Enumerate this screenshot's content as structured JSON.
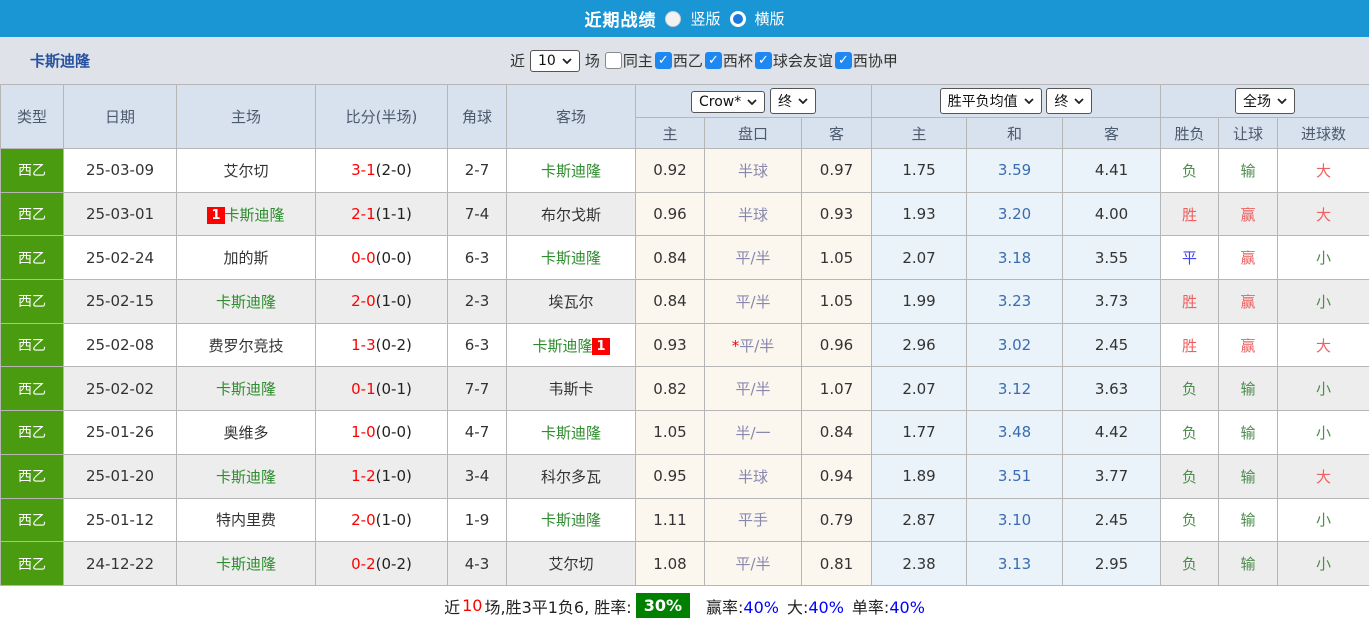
{
  "header_bar": {
    "title": "近期战绩",
    "radio_vertical_label": "竖版",
    "radio_horizontal_label": "横版",
    "selected": "横版"
  },
  "filter_bar": {
    "team": "卡斯迪隆",
    "near_label": "近",
    "near_value": "10",
    "games_label": "场",
    "checkboxes": [
      {
        "label": "同主",
        "checked": false
      },
      {
        "label": "西乙",
        "checked": true
      },
      {
        "label": "西杯",
        "checked": true
      },
      {
        "label": "球会友谊",
        "checked": true
      },
      {
        "label": "西协甲",
        "checked": true
      }
    ]
  },
  "table": {
    "static_headers": [
      "类型",
      "日期",
      "主场",
      "比分(半场)",
      "角球",
      "客场"
    ],
    "groups": [
      {
        "select1": "Crow*",
        "select2": "终",
        "cols": [
          "主",
          "盘口",
          "客"
        ]
      },
      {
        "select1": "胜平负均值",
        "select2": "终",
        "cols": [
          "主",
          "和",
          "客"
        ]
      },
      {
        "select1": "全场",
        "select2": null,
        "cols": [
          "胜负",
          "让球",
          "进球数"
        ]
      }
    ],
    "rows": [
      {
        "type": "西乙",
        "date": "25-03-09",
        "home": {
          "name": "艾尔切",
          "highlight": false,
          "badge": null,
          "badge_pos": null
        },
        "score_ft": "3-1",
        "score_ht": "(2-0)",
        "corner": "2-7",
        "away": {
          "name": "卡斯迪隆",
          "highlight": true,
          "badge": null,
          "badge_pos": null
        },
        "odds_home": "0.92",
        "handicap": "半球",
        "handicap_star": false,
        "odds_away": "0.97",
        "avg_home": "1.75",
        "avg_draw": "3.59",
        "avg_away": "4.41",
        "result": {
          "outcome": "负",
          "outcome_color": "green",
          "handicap": "输",
          "handicap_color": "green",
          "goals": "大",
          "goals_color": "red"
        }
      },
      {
        "type": "西乙",
        "date": "25-03-01",
        "home": {
          "name": "卡斯迪隆",
          "highlight": true,
          "badge": "1",
          "badge_pos": "before"
        },
        "score_ft": "2-1",
        "score_ht": "(1-1)",
        "corner": "7-4",
        "away": {
          "name": "布尔戈斯",
          "highlight": false,
          "badge": null,
          "badge_pos": null
        },
        "odds_home": "0.96",
        "handicap": "半球",
        "handicap_star": false,
        "odds_away": "0.93",
        "avg_home": "1.93",
        "avg_draw": "3.20",
        "avg_away": "4.00",
        "result": {
          "outcome": "胜",
          "outcome_color": "red",
          "handicap": "赢",
          "handicap_color": "red",
          "goals": "大",
          "goals_color": "red"
        }
      },
      {
        "type": "西乙",
        "date": "25-02-24",
        "home": {
          "name": "加的斯",
          "highlight": false,
          "badge": null,
          "badge_pos": null
        },
        "score_ft": "0-0",
        "score_ht": "(0-0)",
        "corner": "6-3",
        "away": {
          "name": "卡斯迪隆",
          "highlight": true,
          "badge": null,
          "badge_pos": null
        },
        "odds_home": "0.84",
        "handicap": "平/半",
        "handicap_star": false,
        "odds_away": "1.05",
        "avg_home": "2.07",
        "avg_draw": "3.18",
        "avg_away": "3.55",
        "result": {
          "outcome": "平",
          "outcome_color": "blue",
          "handicap": "赢",
          "handicap_color": "red",
          "goals": "小",
          "goals_color": "green"
        }
      },
      {
        "type": "西乙",
        "date": "25-02-15",
        "home": {
          "name": "卡斯迪隆",
          "highlight": true,
          "badge": null,
          "badge_pos": null
        },
        "score_ft": "2-0",
        "score_ht": "(1-0)",
        "corner": "2-3",
        "away": {
          "name": "埃瓦尔",
          "highlight": false,
          "badge": null,
          "badge_pos": null
        },
        "odds_home": "0.84",
        "handicap": "平/半",
        "handicap_star": false,
        "odds_away": "1.05",
        "avg_home": "1.99",
        "avg_draw": "3.23",
        "avg_away": "3.73",
        "result": {
          "outcome": "胜",
          "outcome_color": "red",
          "handicap": "赢",
          "handicap_color": "red",
          "goals": "小",
          "goals_color": "green"
        }
      },
      {
        "type": "西乙",
        "date": "25-02-08",
        "home": {
          "name": "费罗尔竞技",
          "highlight": false,
          "badge": null,
          "badge_pos": null
        },
        "score_ft": "1-3",
        "score_ht": "(0-2)",
        "corner": "6-3",
        "away": {
          "name": "卡斯迪隆",
          "highlight": true,
          "badge": "1",
          "badge_pos": "after"
        },
        "odds_home": "0.93",
        "handicap": "平/半",
        "handicap_star": true,
        "odds_away": "0.96",
        "avg_home": "2.96",
        "avg_draw": "3.02",
        "avg_away": "2.45",
        "result": {
          "outcome": "胜",
          "outcome_color": "red",
          "handicap": "赢",
          "handicap_color": "red",
          "goals": "大",
          "goals_color": "red"
        }
      },
      {
        "type": "西乙",
        "date": "25-02-02",
        "home": {
          "name": "卡斯迪隆",
          "highlight": true,
          "badge": null,
          "badge_pos": null
        },
        "score_ft": "0-1",
        "score_ht": "(0-1)",
        "corner": "7-7",
        "away": {
          "name": "韦斯卡",
          "highlight": false,
          "badge": null,
          "badge_pos": null
        },
        "odds_home": "0.82",
        "handicap": "平/半",
        "handicap_star": false,
        "odds_away": "1.07",
        "avg_home": "2.07",
        "avg_draw": "3.12",
        "avg_away": "3.63",
        "result": {
          "outcome": "负",
          "outcome_color": "green",
          "handicap": "输",
          "handicap_color": "green",
          "goals": "小",
          "goals_color": "green"
        }
      },
      {
        "type": "西乙",
        "date": "25-01-26",
        "home": {
          "name": "奥维多",
          "highlight": false,
          "badge": null,
          "badge_pos": null
        },
        "score_ft": "1-0",
        "score_ht": "(0-0)",
        "corner": "4-7",
        "away": {
          "name": "卡斯迪隆",
          "highlight": true,
          "badge": null,
          "badge_pos": null
        },
        "odds_home": "1.05",
        "handicap": "半/一",
        "handicap_star": false,
        "odds_away": "0.84",
        "avg_home": "1.77",
        "avg_draw": "3.48",
        "avg_away": "4.42",
        "result": {
          "outcome": "负",
          "outcome_color": "green",
          "handicap": "输",
          "handicap_color": "green",
          "goals": "小",
          "goals_color": "green"
        }
      },
      {
        "type": "西乙",
        "date": "25-01-20",
        "home": {
          "name": "卡斯迪隆",
          "highlight": true,
          "badge": null,
          "badge_pos": null
        },
        "score_ft": "1-2",
        "score_ht": "(1-0)",
        "corner": "3-4",
        "away": {
          "name": "科尔多瓦",
          "highlight": false,
          "badge": null,
          "badge_pos": null
        },
        "odds_home": "0.95",
        "handicap": "半球",
        "handicap_star": false,
        "odds_away": "0.94",
        "avg_home": "1.89",
        "avg_draw": "3.51",
        "avg_away": "3.77",
        "result": {
          "outcome": "负",
          "outcome_color": "green",
          "handicap": "输",
          "handicap_color": "green",
          "goals": "大",
          "goals_color": "red"
        }
      },
      {
        "type": "西乙",
        "date": "25-01-12",
        "home": {
          "name": "特内里费",
          "highlight": false,
          "badge": null,
          "badge_pos": null
        },
        "score_ft": "2-0",
        "score_ht": "(1-0)",
        "corner": "1-9",
        "away": {
          "name": "卡斯迪隆",
          "highlight": true,
          "badge": null,
          "badge_pos": null
        },
        "odds_home": "1.11",
        "handicap": "平手",
        "handicap_star": false,
        "odds_away": "0.79",
        "avg_home": "2.87",
        "avg_draw": "3.10",
        "avg_away": "2.45",
        "result": {
          "outcome": "负",
          "outcome_color": "green",
          "handicap": "输",
          "handicap_color": "green",
          "goals": "小",
          "goals_color": "green"
        }
      },
      {
        "type": "西乙",
        "date": "24-12-22",
        "home": {
          "name": "卡斯迪隆",
          "highlight": true,
          "badge": null,
          "badge_pos": null
        },
        "score_ft": "0-2",
        "score_ht": "(0-2)",
        "corner": "4-3",
        "away": {
          "name": "艾尔切",
          "highlight": false,
          "badge": null,
          "badge_pos": null
        },
        "odds_home": "1.08",
        "handicap": "平/半",
        "handicap_star": false,
        "odds_away": "0.81",
        "avg_home": "2.38",
        "avg_draw": "3.13",
        "avg_away": "2.95",
        "result": {
          "outcome": "负",
          "outcome_color": "green",
          "handicap": "输",
          "handicap_color": "green",
          "goals": "小",
          "goals_color": "green"
        }
      }
    ]
  },
  "footer": {
    "near_label": "近",
    "near_count": "10",
    "summary": "场,胜3平1负6, 胜率:",
    "win_rate": "30%",
    "stats": [
      {
        "label": "赢率:",
        "value": "40%"
      },
      {
        "label": "大:",
        "value": "40%"
      },
      {
        "label": "单率:",
        "value": "40%"
      }
    ]
  },
  "colors": {
    "topbar_blue": "#1b96d5",
    "type_green": "#4b9b10",
    "team_green": "#2d8c2d",
    "score_red": "#fe0000",
    "handicap_purple": "#8888ae",
    "avg_draw_blue": "#3a6cb4",
    "result_red": "#ef5f5f",
    "result_green": "#4e8b4e",
    "result_blue": "#4343f0",
    "badge_green": "#008000",
    "footer_value_blue": "#0000ff"
  }
}
